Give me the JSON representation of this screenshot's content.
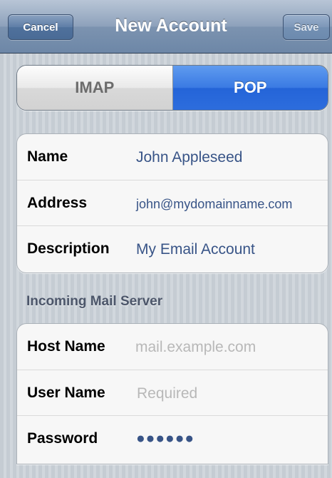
{
  "navbar": {
    "cancel_label": "Cancel",
    "title": "New Account",
    "save_label": "Save"
  },
  "account_type": {
    "options": [
      "IMAP",
      "POP"
    ],
    "selected": "POP"
  },
  "account_info": {
    "name_label": "Name",
    "name_value": "John Appleseed",
    "address_label": "Address",
    "address_value": "john@mydomainname.com",
    "description_label": "Description",
    "description_value": "My Email Account"
  },
  "incoming": {
    "header": "Incoming Mail Server",
    "host_label": "Host Name",
    "host_placeholder": "mail.example.com",
    "user_label": "User Name",
    "user_placeholder": "Required",
    "password_label": "Password",
    "password_value": "●●●●●●"
  },
  "colors": {
    "accent": "#2d6ddd",
    "value_text": "#385487",
    "placeholder_text": "#b8b8b8"
  }
}
